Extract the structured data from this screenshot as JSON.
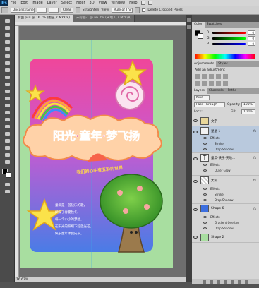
{
  "app": {
    "logo": "Ps"
  },
  "menu": {
    "items": [
      "File",
      "Edit",
      "Image",
      "Layer",
      "Select",
      "Filter",
      "3D",
      "View",
      "Window",
      "Help"
    ]
  },
  "options": {
    "auto_select_value": "Unconstrained",
    "clear_label": "Clear",
    "straighten_label": "Straighten",
    "view_label": "View:",
    "view_value": "Rule of Thirds",
    "delete_cropped_label": "Delete Cropped Pixels"
  },
  "tabs": [
    {
      "label": "封面.psd @ 16.7% (图层, CMYK/8)",
      "active": true
    },
    {
      "label": "未标题-1 @ 66.7% (天地人, CMYK/8)",
      "active": false
    }
  ],
  "status": {
    "zoom": "16.67%"
  },
  "color_panel": {
    "tabs": [
      "Color",
      "Swatches"
    ],
    "channels": [
      {
        "name": "R",
        "value": "0",
        "colors": [
          "#000000",
          "#ff0000"
        ]
      },
      {
        "name": "G",
        "value": "0",
        "colors": [
          "#000000",
          "#00ff00"
        ]
      },
      {
        "name": "B",
        "value": "0",
        "colors": [
          "#000000",
          "#0000ff"
        ]
      }
    ]
  },
  "adjust_panel": {
    "tabs": [
      "Adjustments",
      "Styles"
    ],
    "title": "Add an adjustment"
  },
  "layers_panel": {
    "tabs": [
      "Layers",
      "Channels",
      "Paths"
    ],
    "kind_value": "Kind",
    "blend_value": "Pass Through",
    "opacity_label": "Opacity:",
    "opacity_value": "100%",
    "lock_label": "Lock:",
    "fill_label": "Fill:",
    "fill_value": "100%",
    "layers": [
      {
        "name": "文字",
        "kind": "folder",
        "effects": []
      },
      {
        "name": "星星 1",
        "kind": "shape",
        "fx": "fx",
        "effects": [
          "Effects",
          "Stroke",
          "Drop Shadow"
        ]
      },
      {
        "name": "童年·快乐·天地...",
        "kind": "text",
        "fx": "fx",
        "effects": [
          "Effects",
          "Outer Glow"
        ]
      },
      {
        "name": "大树",
        "kind": "image",
        "fx": "fx",
        "effects": [
          "Effects",
          "Stroke",
          "Drop Shadow"
        ]
      },
      {
        "name": "Shape 6",
        "kind": "shape-blue",
        "fx": "fx",
        "effects": [
          "Effects",
          "Gradient Overlay",
          "Drop Shadow"
        ]
      },
      {
        "name": "Shape 2",
        "kind": "shape-green",
        "effects": []
      }
    ]
  },
  "artwork": {
    "headline": "阳光·童年·梦飞扬",
    "subtitle": "我们的心中有五彩的世界",
    "body_lines": [
      "童年是一首快乐的歌，",
      "蝴蝶了春夏秋冬。",
      "每一个小小的梦想，",
      "在阳光的照耀下绽放光芒。",
      "快乐童年伴我成长。"
    ]
  }
}
